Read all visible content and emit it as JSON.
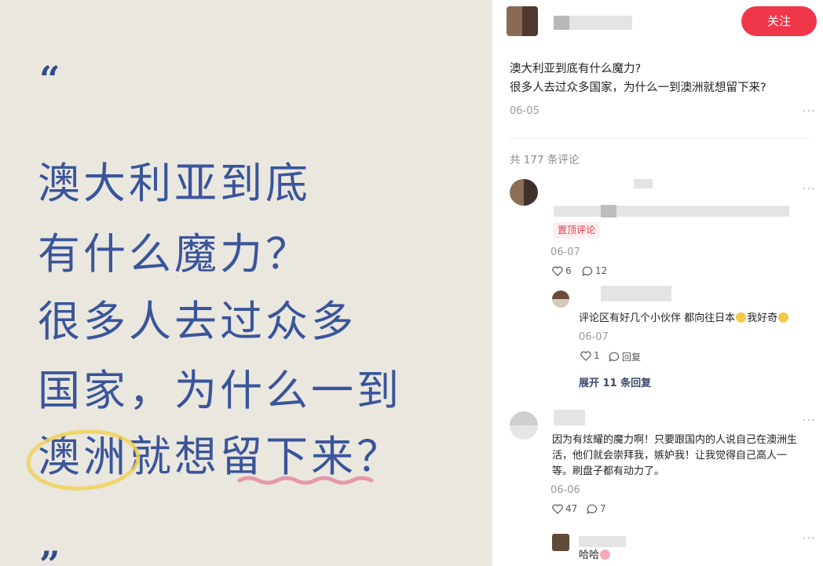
{
  "image_card": {
    "quote_open": "“",
    "quote_close": "”",
    "lines": [
      "澳大利亚到底",
      "有什么魔力？",
      "很多人去过众多",
      "国家，为什么一到",
      "澳洲就想留下来？"
    ]
  },
  "post": {
    "follow_label": "关注",
    "title": "澳大利亚到底有什么魔力?",
    "body": "很多人去过众多国家，为什么一到澳洲就想留下来?",
    "date": "06-05",
    "more": "···"
  },
  "comments_count": "共 177 条评论",
  "comments": [
    {
      "pin_label": "置顶评论",
      "date": "06-07",
      "likes": "6",
      "replies_count": "12",
      "reply": {
        "text": "评论区有好几个小伙伴 都向往日本",
        "text_tail": "我好奇",
        "date": "06-07",
        "likes": "1",
        "reply_label": "回复",
        "expand_label": "展开 11 条回复"
      }
    },
    {
      "text": "因为有炫耀的魔力啊！只要跟国内的人说自己在澳洲生活，他们就会崇拜我，嫉妒我！让我觉得自己高人一等。刷盘子都有动力了。",
      "date": "06-06",
      "likes": "47",
      "replies_count": "7",
      "reply": {
        "text": "哈哈"
      }
    }
  ],
  "colors": {
    "accent": "#f0374a",
    "headline": "#3a559a",
    "card_bg": "#eae7df"
  }
}
